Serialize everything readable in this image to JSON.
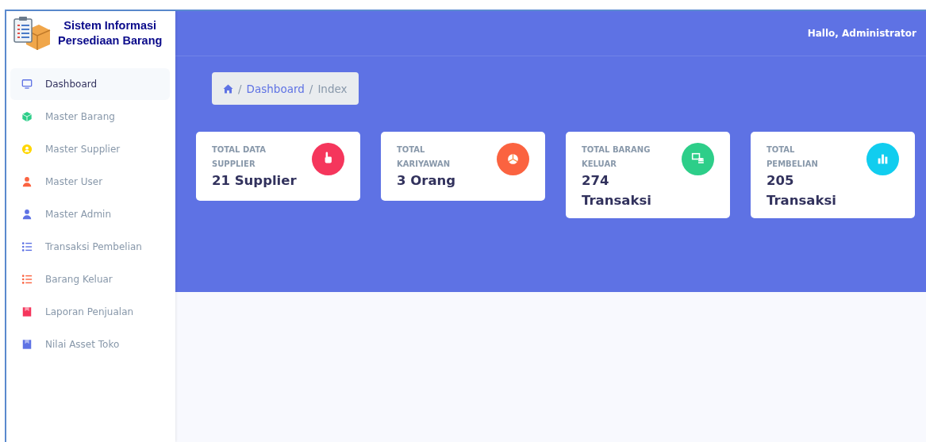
{
  "brand": {
    "title_lines": [
      "Sistem Informasi",
      "Persediaan Barang"
    ]
  },
  "sidebar": {
    "items": [
      {
        "label": "Dashboard",
        "selected": true,
        "color": "#5e72e4"
      },
      {
        "label": "Master Barang",
        "selected": false,
        "color": "#2dce89"
      },
      {
        "label": "Master Supplier",
        "selected": false,
        "color": "#ffd600"
      },
      {
        "label": "Master User",
        "selected": false,
        "color": "#fb6340"
      },
      {
        "label": "Master Admin",
        "selected": false,
        "color": "#5e72e4"
      },
      {
        "label": "Transaksi Pembelian",
        "selected": false,
        "color": "#5e72e4"
      },
      {
        "label": "Barang Keluar",
        "selected": false,
        "color": "#fb6340"
      },
      {
        "label": "Laporan Penjualan",
        "selected": false,
        "color": "#f5365c"
      },
      {
        "label": "Nilai Asset Toko",
        "selected": false,
        "color": "#5e72e4"
      }
    ]
  },
  "header": {
    "greeting": "Hallo, Administrator"
  },
  "breadcrumb": {
    "items": [
      "Dashboard",
      "Index"
    ],
    "separator": "/"
  },
  "cards": [
    {
      "title": "TOTAL DATA SUPPLIER",
      "value": "21 Supplier",
      "color": "#f5365c"
    },
    {
      "title": "TOTAL KARIYAWAN",
      "value": "3 Orang",
      "color": "#fb6340"
    },
    {
      "title": "TOTAL BARANG KELUAR",
      "value": "274 Transaksi",
      "color": "#2dce89"
    },
    {
      "title": "TOTAL PEMBELIAN",
      "value": "205 Transaksi",
      "color": "#11cdef"
    }
  ]
}
